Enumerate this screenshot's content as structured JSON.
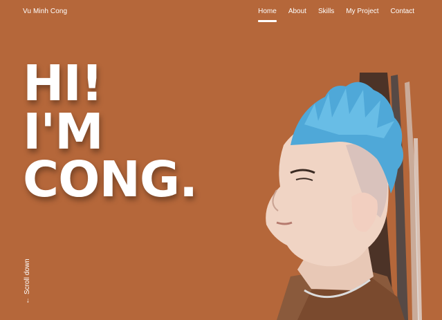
{
  "header": {
    "brand": "Vu Minh Cong",
    "nav": [
      "Home",
      "About",
      "Skills",
      "My Project",
      "Contact"
    ],
    "active_nav": "Home"
  },
  "hero": {
    "lines": [
      "HI!",
      "I'M",
      "CONG."
    ]
  },
  "scroll": {
    "label": "Scroll down",
    "icon": "arrow-left-icon"
  },
  "colors": {
    "background": "#b5673a",
    "text": "#ffffff",
    "hair": "#4fa8d8"
  }
}
